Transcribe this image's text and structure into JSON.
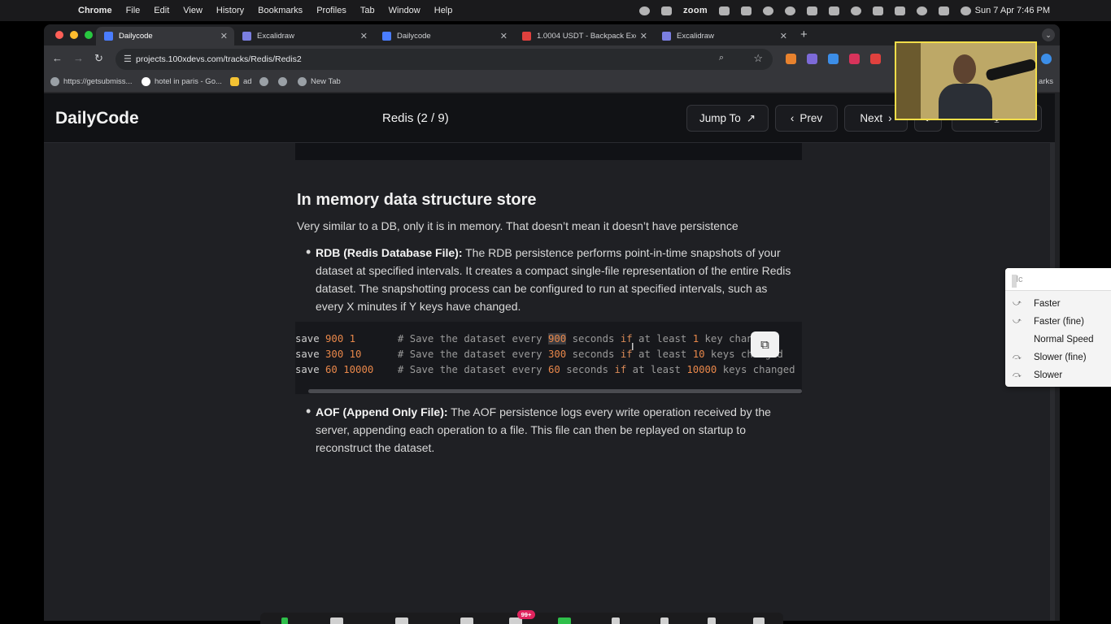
{
  "menubar": {
    "app": "Chrome",
    "items": [
      "File",
      "Edit",
      "View",
      "History",
      "Bookmarks",
      "Profiles",
      "Tab",
      "Window",
      "Help"
    ],
    "zoom_label": "zoom",
    "clock": "Sun 7 Apr  7:46 PM"
  },
  "tabs": [
    {
      "title": "Dailycode",
      "active": true
    },
    {
      "title": "Excalidraw",
      "active": false
    },
    {
      "title": "Dailycode",
      "active": false
    },
    {
      "title": "1.0004 USDT - Backpack Exc",
      "active": false
    },
    {
      "title": "Excalidraw",
      "active": false
    }
  ],
  "address_bar": {
    "url": "projects.100xdevs.com/tracks/Redis/Redis2"
  },
  "bookmarks": [
    "https://getsubmiss...",
    "hotel in paris - Go...",
    "ad",
    "New Tab"
  ],
  "bookmarks_right": "arks",
  "site": {
    "brand": "DailyCode",
    "track_title": "Redis (2 / 9)",
    "jump_to": "Jump To",
    "prev": "Prev",
    "next": "Next"
  },
  "article": {
    "heading": "In memory data structure store",
    "intro": "Very similar to a DB, only it is in memory. That doesn’t mean it doesn’t have persistence",
    "rdb": {
      "term": "RDB (Redis Database File):",
      "text": " The RDB persistence performs point-in-time snapshots of your dataset at specified intervals. It creates a compact single-file representation of the entire Redis dataset. The snapshotting process can be configured to run at specified intervals, such as every X minutes if Y keys have changed."
    },
    "code_lines": [
      {
        "cmd": "save",
        "a": "900",
        "b": "1",
        "pad": "       ",
        "c_pre": "# Save the dataset every ",
        "c_num": "900",
        "c_mid": " seconds ",
        "c_if": "if",
        "c_post": " at least ",
        "c_num2": "1",
        "c_end": " key changed"
      },
      {
        "cmd": "save",
        "a": "300",
        "b": "10",
        "pad": "      ",
        "c_pre": "# Save the dataset every ",
        "c_num": "300",
        "c_mid": " seconds ",
        "c_if": "if",
        "c_post": " at least ",
        "c_num2": "10",
        "c_end": " keys changed"
      },
      {
        "cmd": "save",
        "a": "60",
        "b": "10000",
        "pad": "    ",
        "c_pre": "# Save the dataset every ",
        "c_num": "60",
        "c_mid": " seconds ",
        "c_if": "if",
        "c_post": " at least ",
        "c_num2": "10000",
        "c_end": " keys changed"
      }
    ],
    "aof": {
      "term": "AOF (Append Only File):",
      "text": " The AOF persistence logs every write operation received by the server, appending each operation to a file. This file can then be replayed on startup to reconstruct the dataset."
    }
  },
  "vlc_menu": {
    "search_placeholder": "vlc",
    "options": [
      "Faster",
      "Faster (fine)",
      "Normal Speed",
      "Slower (fine)",
      "Slower"
    ]
  },
  "zoom_toolbar": {
    "participants_badge": "99+"
  },
  "colors": {
    "page_bg": "#1f2024",
    "header_bg": "#111215",
    "code_number": "#e8874a",
    "code_comment": "#9a9a9a",
    "webcam_border": "#f2de4a"
  }
}
